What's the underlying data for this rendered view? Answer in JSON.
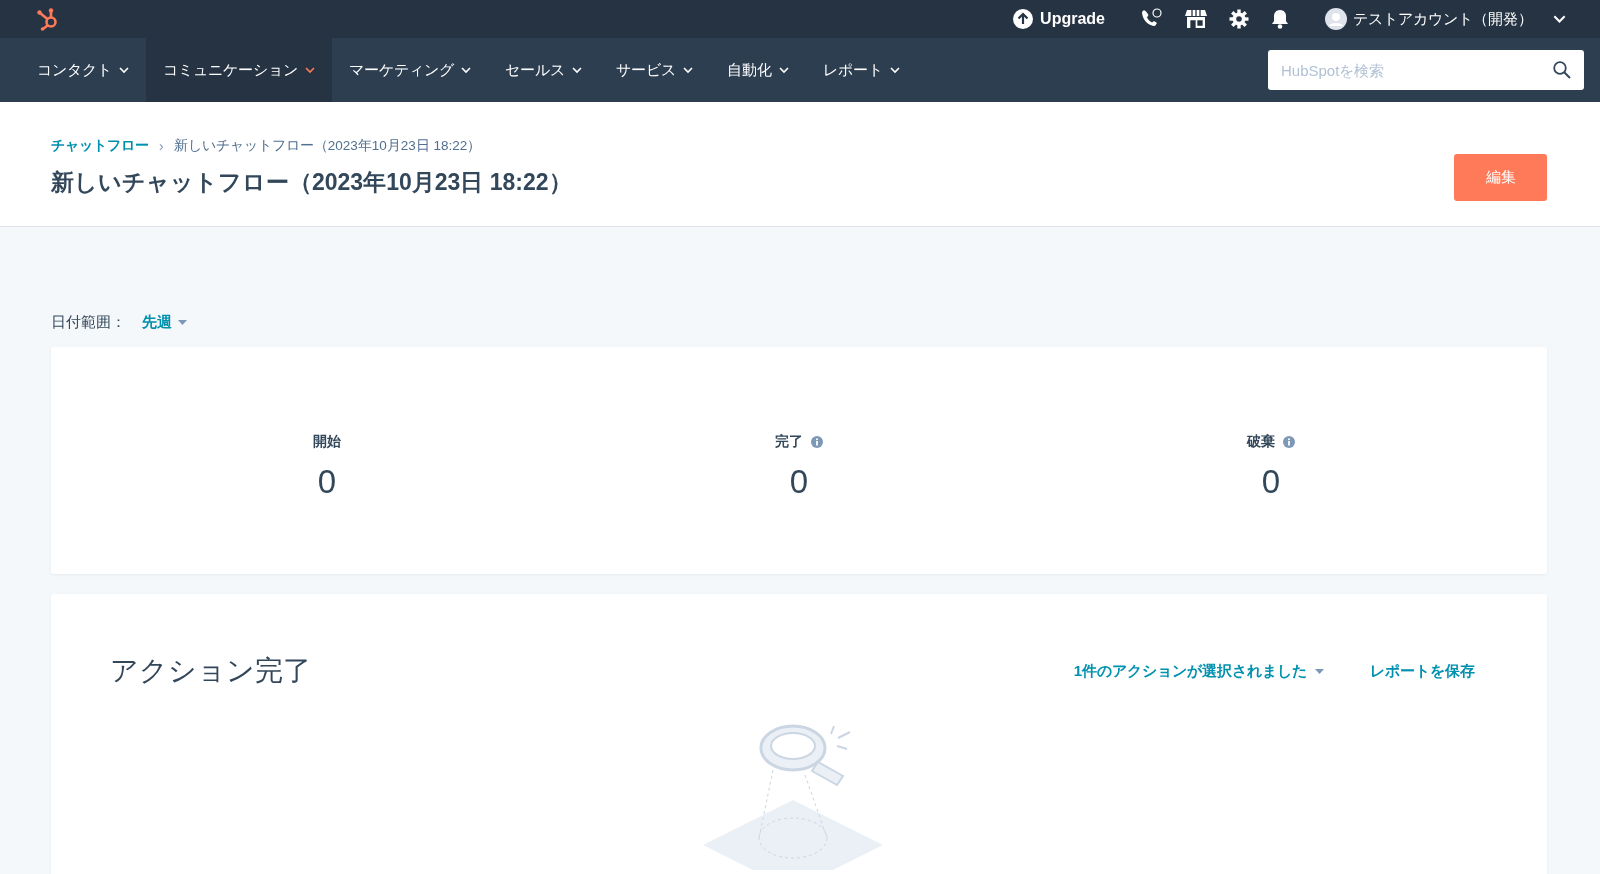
{
  "top_bar": {
    "upgrade": "Upgrade",
    "account": "テストアカウント（開発）"
  },
  "nav": {
    "items": [
      {
        "label": "コンタクト",
        "selected": false
      },
      {
        "label": "コミュニケーション",
        "selected": true
      },
      {
        "label": "マーケティング",
        "selected": false
      },
      {
        "label": "セールス",
        "selected": false
      },
      {
        "label": "サービス",
        "selected": false
      },
      {
        "label": "自動化",
        "selected": false
      },
      {
        "label": "レポート",
        "selected": false
      }
    ],
    "search": {
      "placeholder": "HubSpotを検索"
    }
  },
  "header": {
    "separator": "›",
    "breadcrumb": [
      {
        "label": "チャットフロー",
        "kind": "link"
      },
      {
        "label": "新しいチャットフロー（2023年10月23日 18:22）",
        "kind": "current"
      }
    ],
    "title": "新しいチャットフロー（2023年10月23日 18:22）",
    "edit_button": "編集"
  },
  "date_range": {
    "label": "日付範囲：",
    "value": "先週"
  },
  "stats": [
    {
      "label": "開始",
      "value": "0",
      "info": false
    },
    {
      "label": "完了",
      "value": "0",
      "info": true
    },
    {
      "label": "破棄",
      "value": "0",
      "info": true
    }
  ],
  "report": {
    "title": "アクション完了",
    "action_select": "1件のアクションが選択されました",
    "save_link": "レポートを保存"
  }
}
